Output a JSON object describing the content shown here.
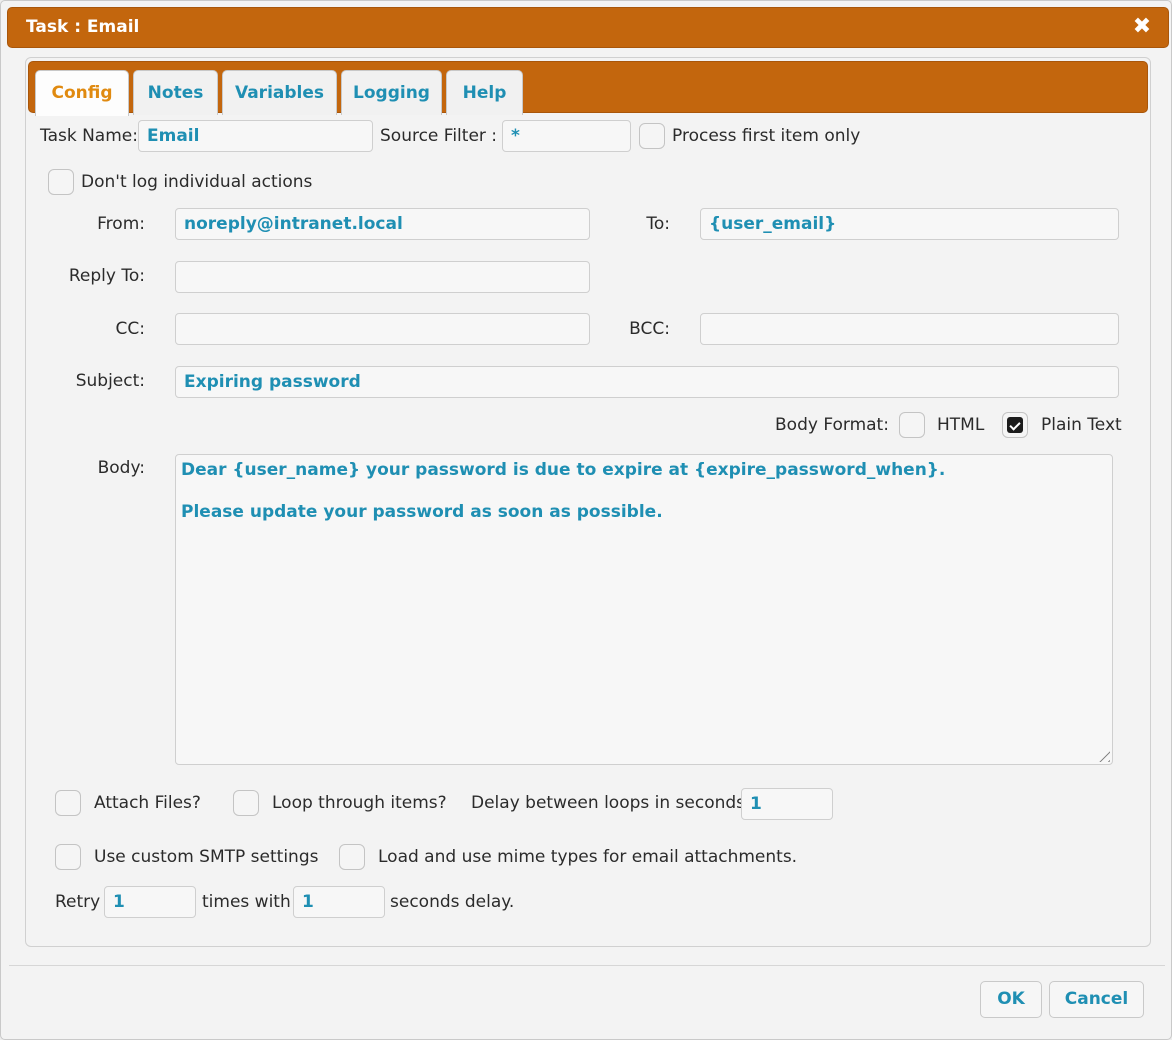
{
  "window": {
    "title": "Task : Email"
  },
  "tabs": [
    {
      "label": "Config",
      "active": true
    },
    {
      "label": "Notes",
      "active": false
    },
    {
      "label": "Variables",
      "active": false
    },
    {
      "label": "Logging",
      "active": false
    },
    {
      "label": "Help",
      "active": false
    }
  ],
  "config": {
    "task_name_label": "Task Name:",
    "task_name_value": "Email",
    "source_filter_label": "Source Filter :",
    "source_filter_value": "*",
    "process_first_label": "Process first item only",
    "process_first_checked": false,
    "dont_log_label": "Don't log individual actions",
    "dont_log_checked": false,
    "from_label": "From:",
    "from_value": "noreply@intranet.local",
    "to_label": "To:",
    "to_value": "{user_email}",
    "reply_to_label": "Reply To:",
    "reply_to_value": "",
    "cc_label": "CC:",
    "cc_value": "",
    "bcc_label": "BCC:",
    "bcc_value": "",
    "subject_label": "Subject:",
    "subject_value": "Expiring password",
    "body_format_label": "Body Format:",
    "html_label": "HTML",
    "html_checked": false,
    "plain_text_label": "Plain Text",
    "plain_text_checked": true,
    "body_label": "Body:",
    "body_line1": "Dear {user_name} your password is due to expire at {expire_password_when}.",
    "body_line2": "Please update your password as soon as possible.",
    "attach_files_label": "Attach Files?",
    "attach_files_checked": false,
    "loop_label": "Loop through items?",
    "loop_checked": false,
    "delay_label": "Delay between loops in seconds:",
    "delay_value": "1",
    "custom_smtp_label": "Use custom SMTP settings",
    "custom_smtp_checked": false,
    "mime_label": "Load and use mime types for email attachments.",
    "mime_checked": false,
    "retry_label": "Retry",
    "retry_times_value": "1",
    "times_with_label": "times with",
    "retry_delay_value": "1",
    "seconds_delay_label": "seconds delay."
  },
  "footer": {
    "ok_label": "OK",
    "cancel_label": "Cancel"
  },
  "colors": {
    "accent": "#c3660d",
    "value_text": "#1f8fb3",
    "active_tab_text": "#e08a10"
  }
}
